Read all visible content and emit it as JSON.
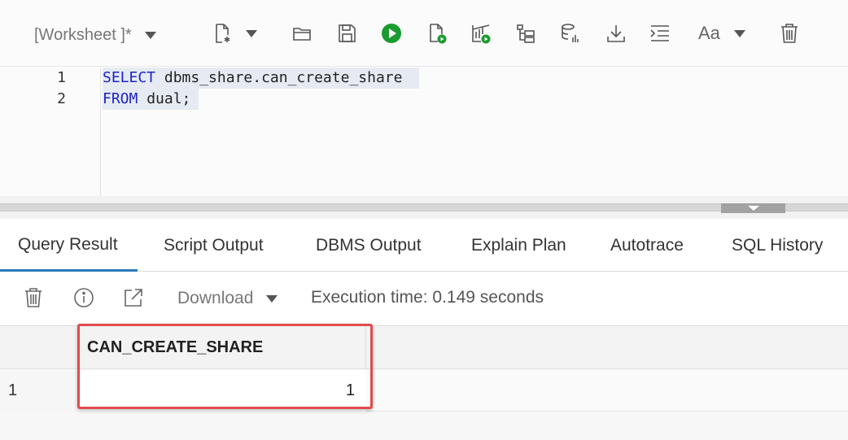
{
  "toolbar": {
    "worksheet_label": "[Worksheet ]*",
    "font_label": "Aa",
    "icons": [
      "new-file-icon",
      "open-folder-icon",
      "save-icon",
      "run-statement-icon",
      "run-script-icon",
      "autotrace-icon",
      "explain-plan-icon",
      "sql-history-icon",
      "download-icon",
      "format-icon",
      "font-size-icon",
      "clear-icon"
    ]
  },
  "editor": {
    "lines": [
      {
        "number": "1",
        "keyword": "SELECT",
        "rest": " dbms_share.can_create_share "
      },
      {
        "number": "2",
        "keyword": "FROM",
        "rest": " dual;"
      }
    ]
  },
  "tabs": [
    {
      "label": "Query Result",
      "active": true
    },
    {
      "label": "Script Output"
    },
    {
      "label": "DBMS Output"
    },
    {
      "label": "Explain Plan"
    },
    {
      "label": "Autotrace"
    },
    {
      "label": "SQL History"
    }
  ],
  "results_toolbar": {
    "download_label": "Download",
    "execution_time": "Execution time: 0.149 seconds"
  },
  "grid": {
    "columns": [
      "CAN_CREATE_SHARE"
    ],
    "rows": [
      {
        "row_number": "1",
        "values": [
          "1"
        ]
      }
    ]
  },
  "colors": {
    "keyword": "#1f22c9",
    "run_green": "#1a9b2f",
    "active_tab": "#2a7ab8",
    "highlight_border": "#e24b4b"
  }
}
